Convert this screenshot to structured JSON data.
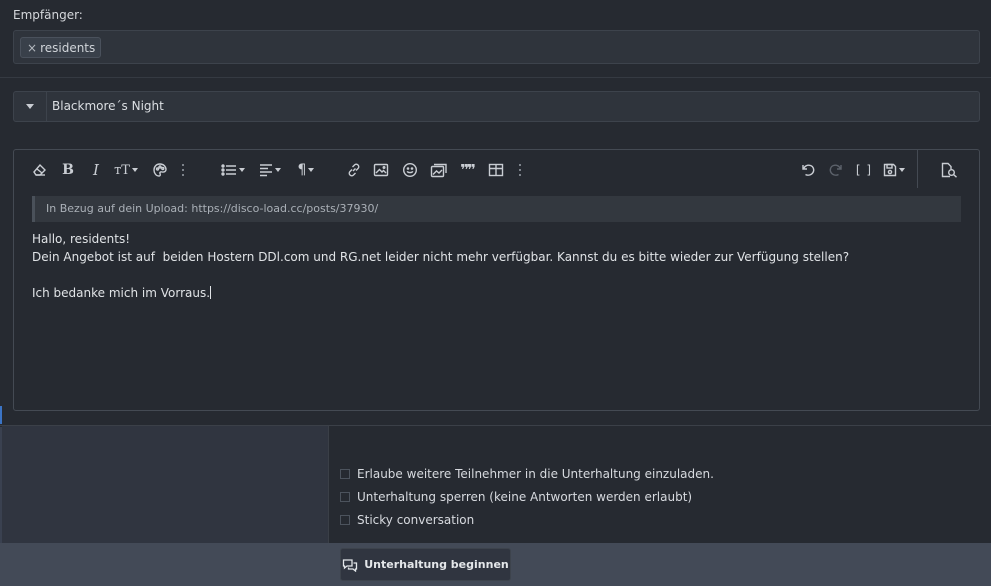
{
  "recipients": {
    "label": "Empfänger:",
    "chips": [
      {
        "remove_glyph": "×",
        "name": "residents"
      }
    ]
  },
  "title_field": {
    "prefix_toggle_icon": "caret-down-icon",
    "value": "Blackmore´s Night"
  },
  "toolbar": {
    "left_group": [
      "eraser-icon",
      "bold-icon",
      "italic-icon",
      "text-size-icon",
      "palette-icon",
      "more-icon",
      "list-icon",
      "align-icon",
      "paragraph-icon",
      "link-icon",
      "image-icon",
      "smilie-icon",
      "media-icon",
      "quote-icon",
      "table-icon",
      "more-icon"
    ],
    "right_group": [
      "undo-icon",
      "redo-icon",
      "bbcode-toggle-icon",
      "drafts-icon",
      "preview-icon"
    ],
    "bold_glyph": "B",
    "italic_glyph": "I",
    "text_size_glyph": "тT",
    "paragraph_glyph": "¶",
    "quote_glyph": "❞❞",
    "bbcode_glyph": "[ ]"
  },
  "editor": {
    "quote_text": "In Bezug auf dein Upload: https://disco-load.cc/posts/37930/",
    "lines": [
      "Hallo, residents!",
      "Dein Angebot ist auf  beiden Hostern DDl.com und RG.net leider nicht mehr verfügbar. Kannst du es bitte wieder zur Verfügung stellen?",
      "",
      "Ich bedanke mich im Vorraus."
    ]
  },
  "options": [
    {
      "label": "Erlaube weitere Teilnehmer in die Unterhaltung einzuladen.",
      "checked": false
    },
    {
      "label": "Unterhaltung sperren (keine Antworten werden erlaubt)",
      "checked": false
    },
    {
      "label": "Sticky conversation",
      "checked": false
    }
  ],
  "submit": {
    "label": "Unterhaltung beginnen",
    "icon": "conversation-icon"
  }
}
